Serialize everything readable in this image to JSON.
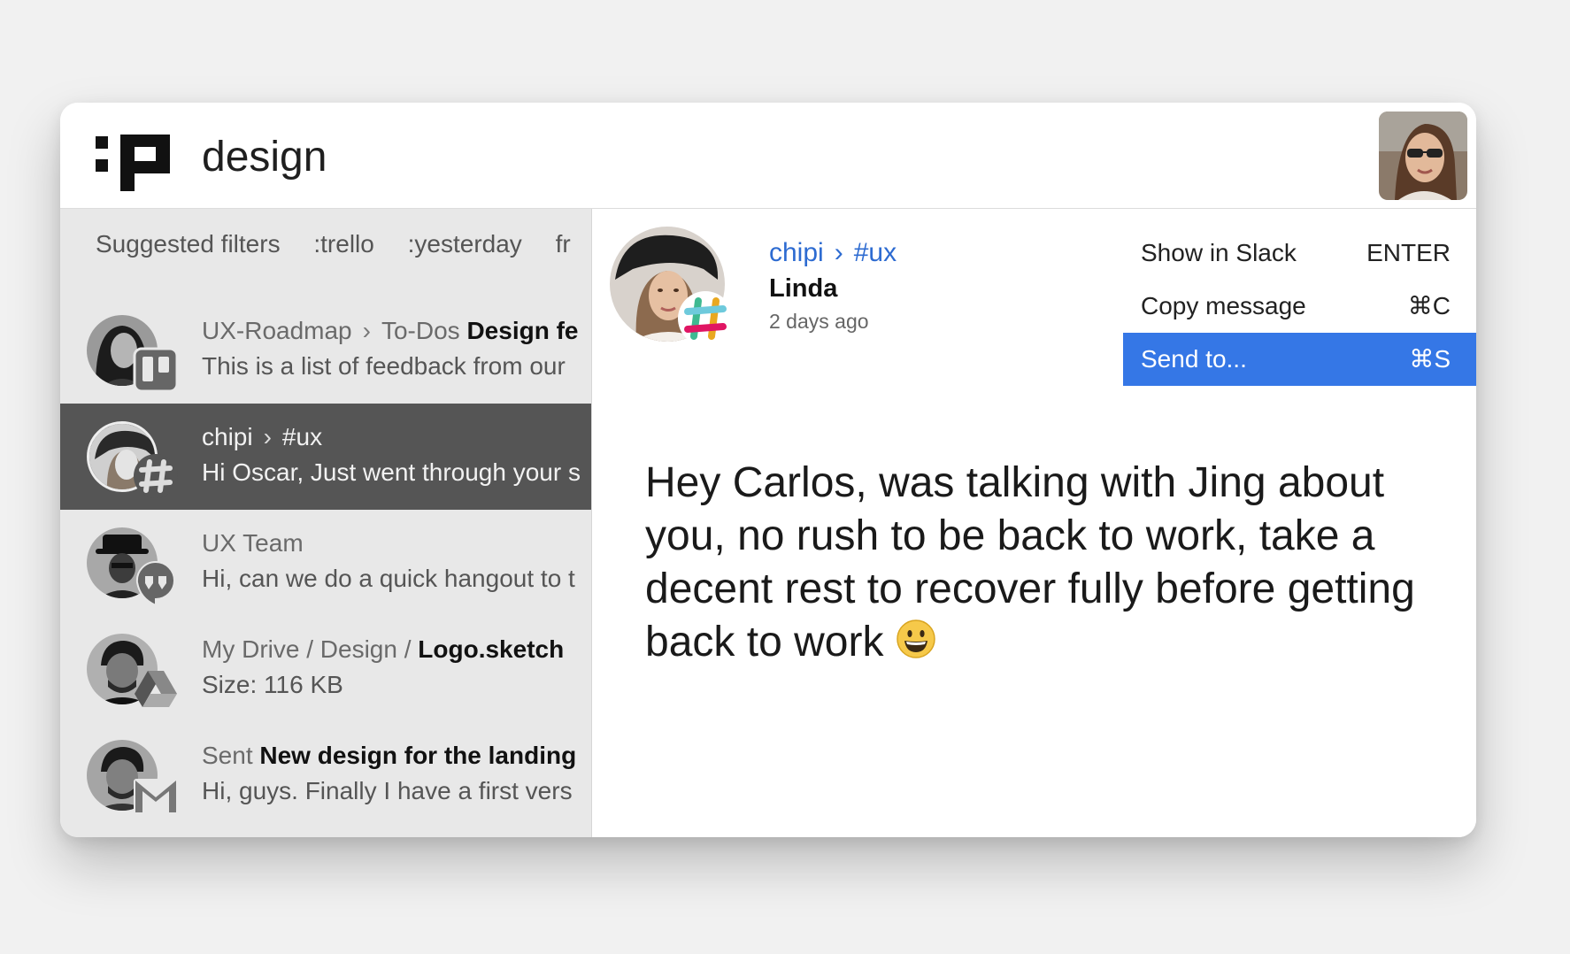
{
  "search": {
    "query": "design"
  },
  "filters": {
    "label": "Suggested filters",
    "items": [
      ":trello",
      ":yesterday",
      "fr"
    ]
  },
  "results": [
    {
      "part1": "UX-Roadmap",
      "sep": "›",
      "part2": "To-Dos",
      "bold": "Design fe",
      "line2": "This is a list of feedback from our",
      "badge": "trello-icon"
    },
    {
      "part1": "chipi",
      "sep": "›",
      "part2": "#ux",
      "bold": "",
      "line2": "Hi Oscar, Just went through your s",
      "badge": "slack-icon"
    },
    {
      "part1": "UX Team",
      "sep": "",
      "part2": "",
      "bold": "",
      "line2": "Hi, can we do a quick hangout to t",
      "badge": "hangouts-icon"
    },
    {
      "part1": "My Drive / Design /",
      "sep": "",
      "part2": "",
      "bold": "Logo.sketch",
      "line2": "Size: 116 KB",
      "badge": "google-drive-icon"
    },
    {
      "part1": "Sent",
      "sep": "",
      "part2": "",
      "bold": "New design for the landing",
      "line2": "Hi, guys. Finally I have a first vers",
      "badge": "gmail-icon"
    }
  ],
  "detail": {
    "channel_user": "chipi",
    "channel_sep": "›",
    "channel": "#ux",
    "sender_name": "Linda",
    "time": "2 days ago",
    "message": "Hey Carlos, was talking with Jing about you, no rush to be back to work, take a decent rest to recover fully before getting back to work"
  },
  "menu": [
    {
      "label": "Show in Slack",
      "shortcut": "ENTER"
    },
    {
      "label": "Copy message",
      "shortcut": "⌘C"
    },
    {
      "label": "Send to...",
      "shortcut": "⌘S"
    }
  ],
  "colors": {
    "accent": "#3577e6",
    "link": "#2d6bd1",
    "selected_row": "#555555"
  }
}
